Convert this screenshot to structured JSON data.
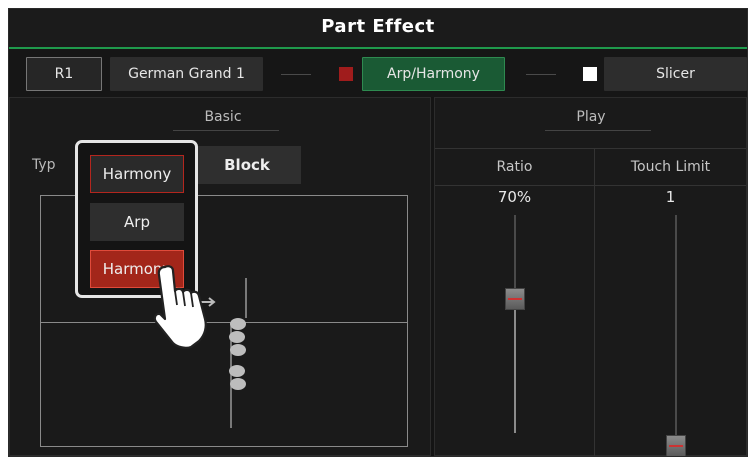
{
  "header": {
    "title": "Part Effect"
  },
  "toolbar": {
    "part": "R1",
    "voice": "German Grand 1",
    "arp_harmony": "Arp/Harmony",
    "slicer": "Slicer",
    "colors": {
      "arp_indicator": "#a01c1c",
      "slicer_indicator": "#ffffff",
      "active": "#1a5a34"
    }
  },
  "basic": {
    "section_label": "Basic",
    "type_label": "Typ",
    "type_value": "Harmony",
    "block_label": "Block"
  },
  "dropdown": {
    "options": [
      "Harmony",
      "Arp",
      "Harmony"
    ],
    "selected": "Harmony"
  },
  "play": {
    "section_label": "Play",
    "ratio": {
      "label": "Ratio",
      "value": "70%",
      "level": 0.7
    },
    "touch_limit": {
      "label": "Touch Limit",
      "value": "1",
      "level": 0.0
    }
  }
}
